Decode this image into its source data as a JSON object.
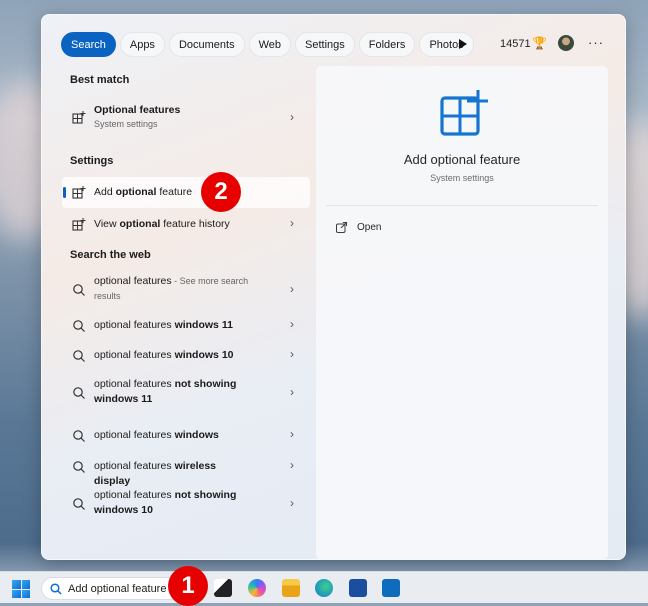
{
  "tabs": [
    {
      "label": "Search",
      "active": true
    },
    {
      "label": "Apps"
    },
    {
      "label": "Documents"
    },
    {
      "label": "Web"
    },
    {
      "label": "Settings"
    },
    {
      "label": "Folders"
    },
    {
      "label": "Photos"
    }
  ],
  "header": {
    "points": "14571",
    "more": "···"
  },
  "best_match": {
    "heading": "Best match",
    "title": "Optional features",
    "subtitle": "System settings"
  },
  "settings": {
    "heading": "Settings",
    "items": [
      {
        "pre": "Add ",
        "bold": "optional",
        "post": " feature",
        "selected": true
      },
      {
        "pre": "View ",
        "bold": "optional",
        "post": " feature history"
      }
    ]
  },
  "web": {
    "heading": "Search the web",
    "items": [
      {
        "pre": "optional features",
        "bold": "",
        "post": "",
        "note": " - See more search results"
      },
      {
        "pre": "optional features ",
        "bold": "windows 11"
      },
      {
        "pre": "optional features ",
        "bold": "windows 10"
      },
      {
        "pre": "optional features ",
        "bold": "not showing windows 11"
      },
      {
        "pre": "optional features ",
        "bold": "windows"
      },
      {
        "pre": "optional features ",
        "bold": "wireless display"
      },
      {
        "pre": "optional features ",
        "bold": "not showing windows 10"
      }
    ]
  },
  "detail": {
    "title": "Add optional feature",
    "subtitle": "System settings",
    "action": "Open"
  },
  "taskbar": {
    "search_value": "Add optional feature"
  },
  "badges": {
    "one": "1",
    "two": "2"
  },
  "colors": {
    "accent": "#0b63c1",
    "badge": "#e60000"
  }
}
